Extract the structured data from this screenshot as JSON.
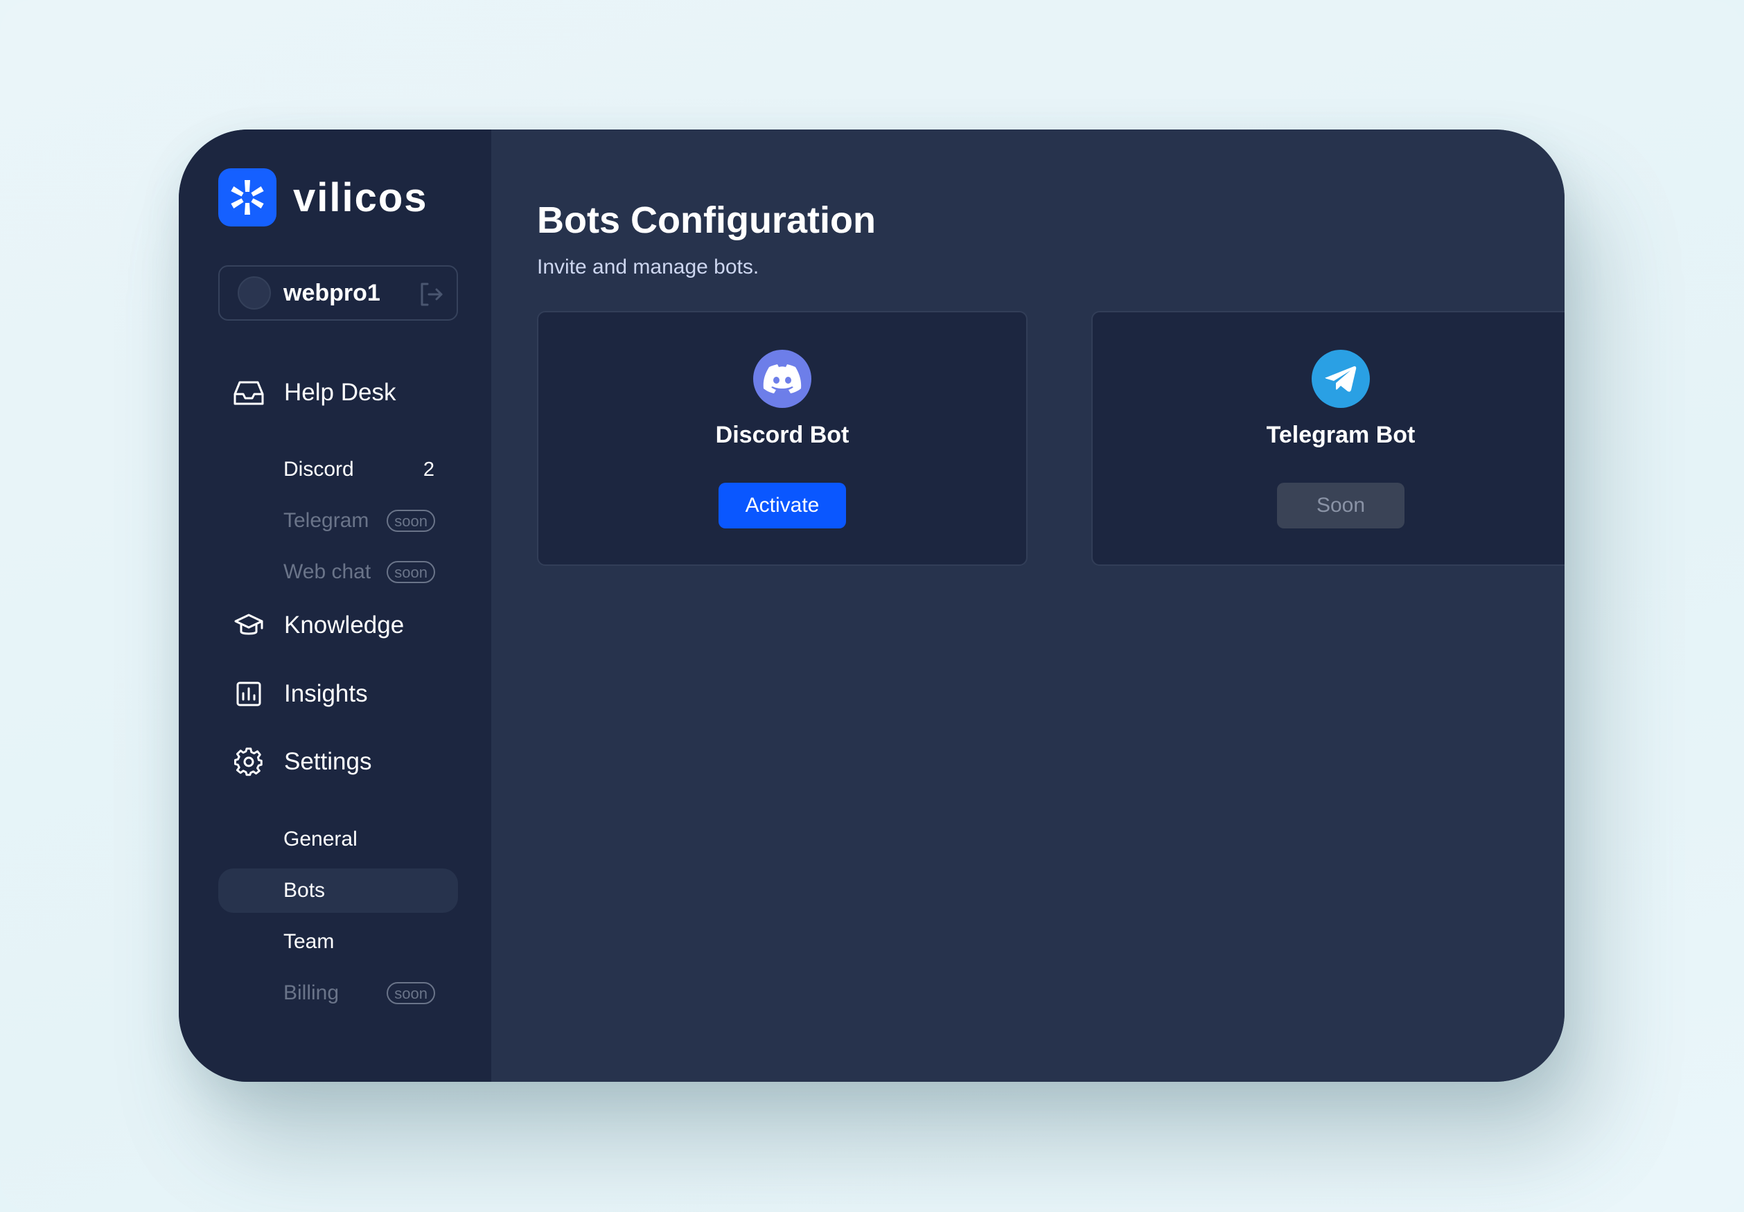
{
  "brand": {
    "name": "vilicos"
  },
  "user": {
    "username": "webpro1"
  },
  "sidebar": {
    "helpdesk": {
      "label": "Help Desk",
      "items": [
        {
          "label": "Discord",
          "count": "2"
        },
        {
          "label": "Telegram",
          "badge": "soon"
        },
        {
          "label": "Web chat",
          "badge": "soon"
        }
      ]
    },
    "knowledge": {
      "label": "Knowledge"
    },
    "insights": {
      "label": "Insights"
    },
    "settings": {
      "label": "Settings",
      "items": [
        {
          "label": "General"
        },
        {
          "label": "Bots",
          "active": true
        },
        {
          "label": "Team"
        },
        {
          "label": "Billing",
          "badge": "soon"
        }
      ]
    }
  },
  "main": {
    "title": "Bots Configuration",
    "subtitle": "Invite and manage bots.",
    "cards": [
      {
        "name": "Discord Bot",
        "button": "Activate",
        "icon": "discord-icon"
      },
      {
        "name": "Telegram Bot",
        "button": "Soon",
        "icon": "telegram-icon"
      }
    ]
  },
  "colors": {
    "page_bg": "#e8f5f9",
    "sidebar_bg": "#1c2640",
    "main_bg": "#27334d",
    "accent": "#0a57ff",
    "disabled_text": "#6a7489"
  }
}
